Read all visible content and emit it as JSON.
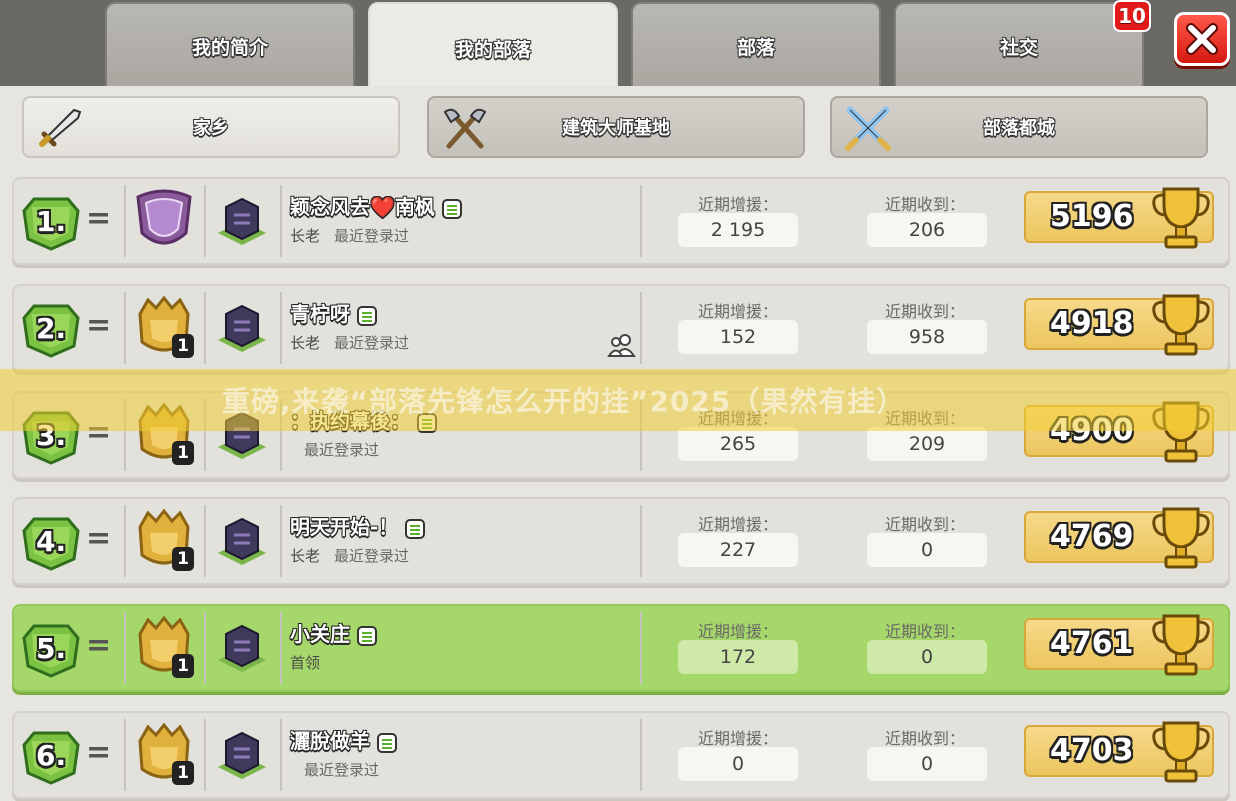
{
  "tabs": [
    {
      "label": "我的简介",
      "active": false
    },
    {
      "label": "我的部落",
      "active": true
    },
    {
      "label": "部落",
      "active": false
    },
    {
      "label": "社交",
      "active": false
    }
  ],
  "notification_count": "10",
  "close_icon": "close-x-icon",
  "subtabs": [
    {
      "label": "家乡",
      "icon": "sword-icon",
      "active": true
    },
    {
      "label": "建筑大师基地",
      "icon": "crossed-axes-icon",
      "active": false
    },
    {
      "label": "部落都城",
      "icon": "crossed-swords-icon",
      "active": false
    }
  ],
  "labels": {
    "donated": "近期增援：",
    "received": "近期收到："
  },
  "members": [
    {
      "rank": "1.",
      "name": "颖念风去❤️南枫",
      "role": "长老",
      "last_seen": "最近登录过",
      "donated": "2 195",
      "received": "206",
      "trophies": "5196",
      "league": "legend-league-icon",
      "th_level": "",
      "friend": false,
      "highlight": false
    },
    {
      "rank": "2.",
      "name": "青柠呀",
      "role": "长老",
      "last_seen": "最近登录过",
      "donated": "152",
      "received": "958",
      "trophies": "4918",
      "league": "titan-league-icon",
      "th_level": "1",
      "friend": true,
      "highlight": false
    },
    {
      "rank": "3.",
      "name": "：执约幕後：",
      "role": "",
      "last_seen": "最近登录过",
      "donated": "265",
      "received": "209",
      "trophies": "4900",
      "league": "titan-league-icon",
      "th_level": "1",
      "friend": false,
      "highlight": false
    },
    {
      "rank": "4.",
      "name": "明天开始-！",
      "role": "长老",
      "last_seen": "最近登录过",
      "donated": "227",
      "received": "0",
      "trophies": "4769",
      "league": "titan-league-icon",
      "th_level": "1",
      "friend": false,
      "highlight": false
    },
    {
      "rank": "5.",
      "name": "小关庄",
      "role": "首领",
      "last_seen": "",
      "donated": "172",
      "received": "0",
      "trophies": "4761",
      "league": "titan-league-icon",
      "th_level": "1",
      "friend": false,
      "highlight": true
    },
    {
      "rank": "6.",
      "name": "灑脫做羊",
      "role": "",
      "last_seen": "最近登录过",
      "donated": "0",
      "received": "0",
      "trophies": "4703",
      "league": "titan-league-icon",
      "th_level": "1",
      "friend": false,
      "highlight": false
    }
  ],
  "watermark": "重磅,来袭“部落先锋怎么开的挂”2025（果然有挂）",
  "colors": {
    "highlight_row": "#a6d76b",
    "badge_red": "#e11a1a",
    "trophy_gold": "#ecc65e"
  }
}
